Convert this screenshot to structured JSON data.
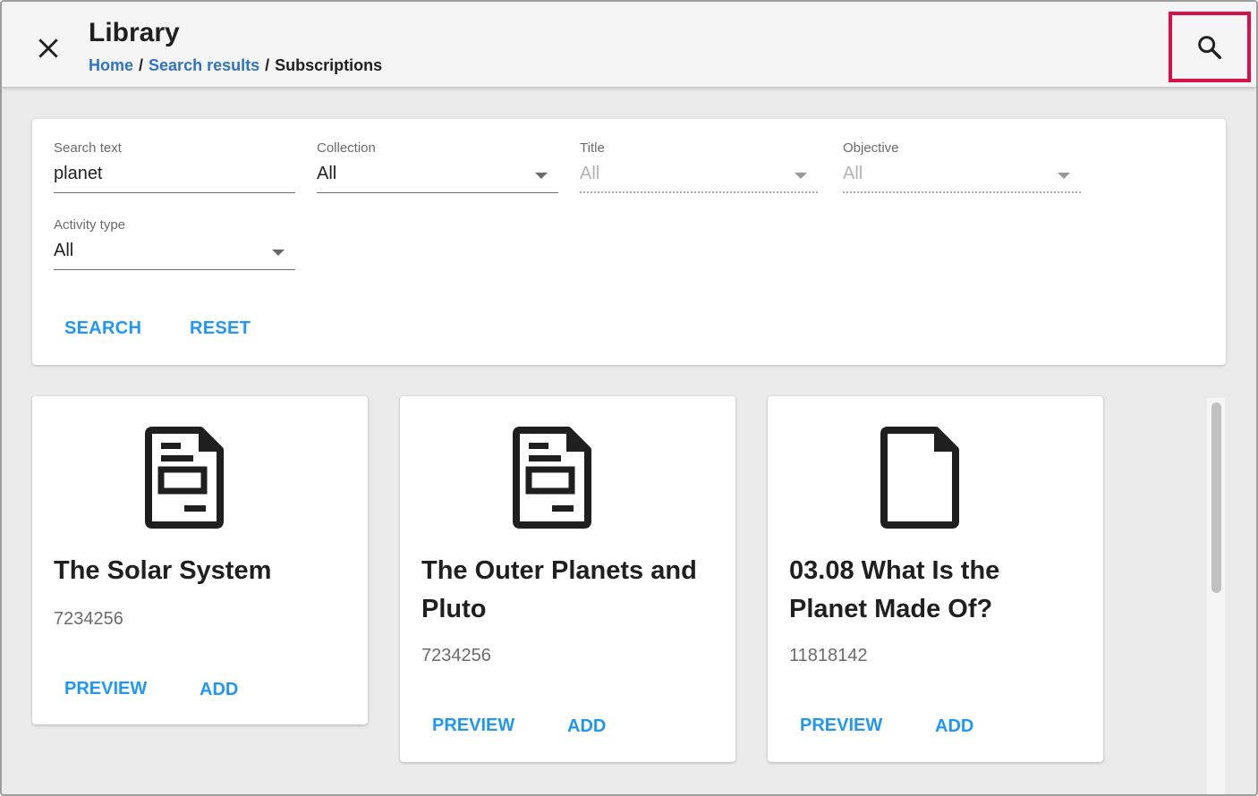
{
  "header": {
    "title": "Library",
    "breadcrumb": {
      "home": "Home",
      "search_results": "Search results",
      "separator": "/",
      "current": "Subscriptions"
    }
  },
  "filters": {
    "search_text": {
      "label": "Search text",
      "value": "planet"
    },
    "collection": {
      "label": "Collection",
      "value": "All"
    },
    "title": {
      "label": "Title",
      "value": "All"
    },
    "objective": {
      "label": "Objective",
      "value": "All"
    },
    "activity_type": {
      "label": "Activity type",
      "value": "All"
    },
    "search_button": "SEARCH",
    "reset_button": "RESET"
  },
  "results": [
    {
      "title": "The Solar System",
      "id": "7234256",
      "icon": "document-lines-icon",
      "preview": "PREVIEW",
      "add": "ADD"
    },
    {
      "title": "The Outer Planets and Pluto",
      "id": "7234256",
      "icon": "document-lines-icon",
      "preview": "PREVIEW",
      "add": "ADD"
    },
    {
      "title": "03.08 What Is the Planet Made Of?",
      "id": "11818142",
      "icon": "document-blank-icon",
      "preview": "PREVIEW",
      "add": "ADD"
    }
  ],
  "colors": {
    "accent": "#2196f3",
    "link": "#2f74c0",
    "highlight": "#d6114a"
  }
}
